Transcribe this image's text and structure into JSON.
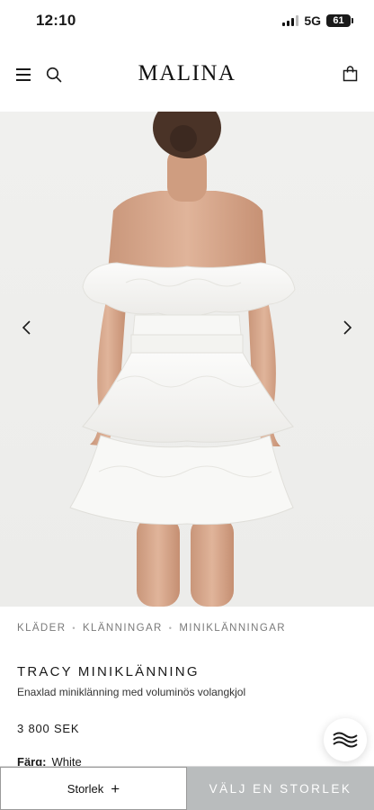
{
  "status_bar": {
    "time": "12:10",
    "network": "5G",
    "battery": "61"
  },
  "header": {
    "logo": "MALINA",
    "icons": [
      "menu-icon",
      "search-icon",
      "shopping-bag-icon"
    ]
  },
  "gallery": {
    "image_description_icon": "product-photo",
    "prev_icon": "chevron-left-icon",
    "next_icon": "chevron-right-icon"
  },
  "breadcrumb": {
    "items": [
      "KLÄDER",
      "KLÄNNINGAR",
      "MINIKLÄNNINGAR"
    ]
  },
  "product": {
    "title": "TRACY MINIKLÄNNING",
    "subtitle": "Enaxlad miniklänning med voluminös volangkjol",
    "price": "3 800 SEK",
    "color_label": "Färg:",
    "color_value": "White"
  },
  "chat": {
    "icon": "chat-icon"
  },
  "bottom_bar": {
    "size_label": "Storlek",
    "size_plus": "+",
    "cta_label": "VÄLJ EN STORLEK"
  },
  "colors": {
    "cta_background": "#b9bcbd",
    "hero_background": "#eeeeec"
  }
}
